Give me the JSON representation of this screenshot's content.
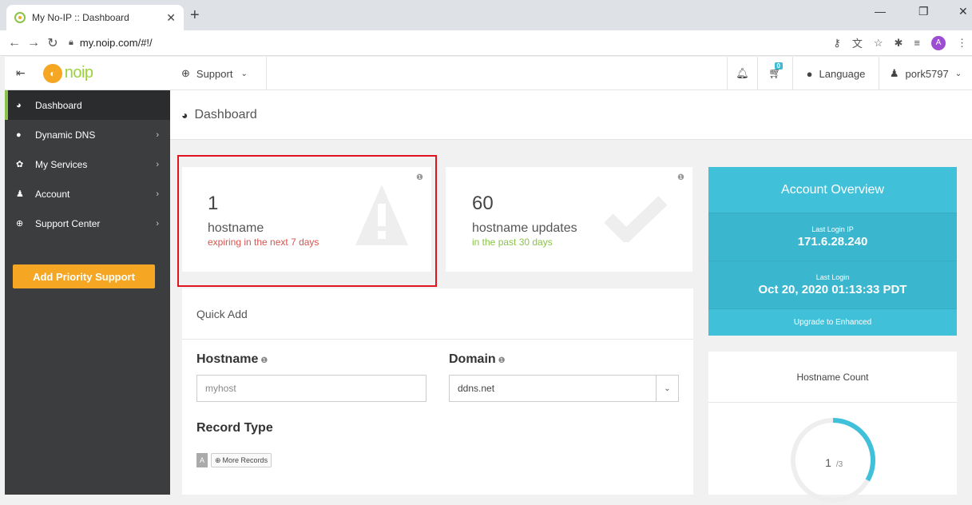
{
  "browser": {
    "tab_title": "My No-IP :: Dashboard",
    "url": "my.noip.com/#!/",
    "avatar_letter": "A"
  },
  "brand": {
    "logo_text": "noip"
  },
  "sidebar": {
    "items": [
      {
        "label": "Dashboard",
        "active": true
      },
      {
        "label": "Dynamic DNS"
      },
      {
        "label": "My Services"
      },
      {
        "label": "Account"
      },
      {
        "label": "Support Center"
      }
    ],
    "priority_button": "Add Priority Support"
  },
  "topnav": {
    "support": "Support",
    "language": "Language",
    "user": "pork5797",
    "cart_count": "0"
  },
  "page": {
    "title": "Dashboard"
  },
  "stats": {
    "expiring": {
      "count": "1",
      "label": "hostname",
      "sub": "expiring in the next 7 days"
    },
    "updates": {
      "count": "60",
      "label": "hostname updates",
      "sub": "in the past 30 days"
    }
  },
  "overview": {
    "title": "Account Overview",
    "last_ip_label": "Last Login IP",
    "last_ip": "171.6.28.240",
    "last_login_label": "Last Login",
    "last_login": "Oct 20, 2020 01:13:33 PDT",
    "upgrade": "Upgrade to Enhanced"
  },
  "quick_add": {
    "title": "Quick Add",
    "hostname_label": "Hostname",
    "hostname_placeholder": "myhost",
    "domain_label": "Domain",
    "domain_value": "ddns.net",
    "record_type_label": "Record Type",
    "record_a": "A",
    "more_records": "More Records"
  },
  "hostname_count": {
    "title": "Hostname Count",
    "used": "1",
    "total": "/3",
    "fraction": 0.333
  },
  "colors": {
    "accent": "#41c0da",
    "warning_red": "#d9534f",
    "success_green": "#8bc34a",
    "priority": "#f5a623"
  }
}
